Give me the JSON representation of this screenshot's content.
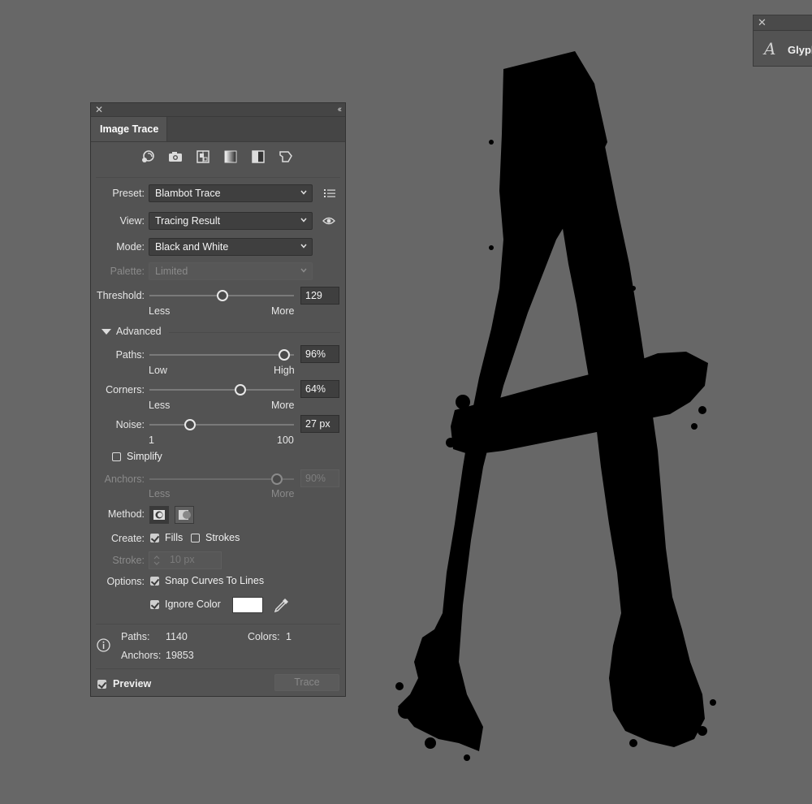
{
  "glyphs_panel": {
    "title": "Glyphs"
  },
  "panel": {
    "title": "Image Trace",
    "preset_icons": [
      "auto-color-icon",
      "high-color-icon",
      "low-color-icon",
      "grayscale-icon",
      "black-white-icon",
      "outline-icon"
    ],
    "preset": {
      "label": "Preset:",
      "value": "Blambot Trace"
    },
    "view": {
      "label": "View:",
      "value": "Tracing Result"
    },
    "mode": {
      "label": "Mode:",
      "value": "Black and White"
    },
    "palette": {
      "label": "Palette:",
      "value": "Limited"
    },
    "threshold": {
      "label": "Threshold:",
      "value": "129",
      "level": 0.5,
      "min_label": "Less",
      "max_label": "More"
    },
    "advanced": {
      "label": "Advanced"
    },
    "paths": {
      "label": "Paths:",
      "value": "96%",
      "level": 0.96,
      "min_label": "Low",
      "max_label": "High"
    },
    "corners": {
      "label": "Corners:",
      "value": "64%",
      "level": 0.64,
      "min_label": "Less",
      "max_label": "More"
    },
    "noise": {
      "label": "Noise:",
      "value": "27 px",
      "level": 0.27,
      "min_label": "1",
      "max_label": "100"
    },
    "simplify": {
      "label": "Simplify",
      "checked": false
    },
    "anchors": {
      "label": "Anchors:",
      "value": "90%",
      "level": 0.9,
      "min_label": "Less",
      "max_label": "More"
    },
    "method": {
      "label": "Method:"
    },
    "create": {
      "label": "Create:",
      "fills": "Fills",
      "strokes": "Strokes",
      "fills_checked": true,
      "strokes_checked": false
    },
    "stroke": {
      "label": "Stroke:",
      "value": "10 px"
    },
    "options": {
      "label": "Options:",
      "snap": "Snap Curves To Lines",
      "snap_checked": true,
      "ignore_color": "Ignore Color",
      "ignore_checked": true,
      "ignore_color_swatch": "#ffffff"
    },
    "stats": {
      "paths_label": "Paths:",
      "paths_value": "1140",
      "colors_label": "Colors:",
      "colors_value": "1",
      "anchors_label": "Anchors:",
      "anchors_value": "19853"
    },
    "preview": {
      "label": "Preview",
      "checked": true
    },
    "trace_button": "Trace"
  }
}
